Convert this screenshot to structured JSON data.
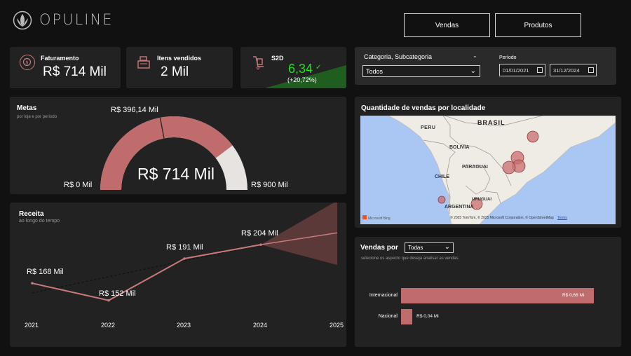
{
  "header": {
    "brand": "OPULINE",
    "nav": {
      "vendas": "Vendas",
      "produtos": "Produtos"
    }
  },
  "kpis": {
    "faturamento": {
      "title": "Faturamento",
      "value": "R$ 714 Mil"
    },
    "itens": {
      "title": "Itens vendidos",
      "value": "2 Mil"
    },
    "s2d": {
      "title": "S2D",
      "value": "6,34",
      "delta": "(+20,72%)",
      "accent": "#1ee01e"
    }
  },
  "filters": {
    "categoria_label": "Categoria, Subcategoria",
    "categoria_value": "Todos",
    "periodo_label": "Período",
    "date_start": "01/01/2021",
    "date_end": "31/12/2024"
  },
  "metas": {
    "title": "Metas",
    "subtitle": "por loja e por período",
    "center_value": "R$ 714 Mil",
    "min_label": "R$ 0 Mil",
    "max_label": "R$ 900 Mil",
    "target_label": "R$ 396,14 Mil",
    "value": 714,
    "min": 0,
    "max": 900,
    "target": 396.14,
    "fill_color": "#c06c6c",
    "rest_color": "#e7e3e0"
  },
  "mapa": {
    "title": "Quantidade de vendas por localidade",
    "labels": [
      "PERU",
      "BRASIL",
      "BOLIVIA",
      "PARAGUAI",
      "CHILE",
      "URUGUAI",
      "ARGENTINA"
    ],
    "attribution": "© 2025 TomTom, © 2025 Microsoft Corporation, © OpenStreetMap",
    "terms": "Terms",
    "bing": "Microsoft Bing"
  },
  "receita": {
    "title": "Receita",
    "subtitle": "ao longo do tempo"
  },
  "vendas_por": {
    "title": "Vendas por",
    "select_value": "Todas",
    "subtitle": "selecione os aspecto que deseja analisar as vendas",
    "bars": [
      {
        "label": "Internacional",
        "value": 0.68,
        "value_label": "R$ 0,68 Mi"
      },
      {
        "label": "Nacional",
        "value": 0.04,
        "value_label": "R$ 0,04 Mi"
      }
    ],
    "bar_color": "#c06c6c"
  },
  "chart_data": [
    {
      "type": "line",
      "title": "Receita",
      "x": [
        "2021",
        "2022",
        "2023",
        "2024",
        "2025"
      ],
      "series": [
        {
          "values": [
            168,
            152,
            191,
            204,
            null
          ]
        }
      ],
      "data_labels": [
        "R$ 168 Mil",
        "R$ 152 Mil",
        "R$ 191 Mil",
        "R$ 204 Mil"
      ],
      "forecast": {
        "from": "2024",
        "to": "2025",
        "value_2025": 215,
        "upper_2025": 245,
        "lower_2025": 185
      },
      "ylim": [
        140,
        225
      ],
      "line_color": "#c87a7a"
    },
    {
      "type": "bar",
      "title": "Vendas por",
      "categories": [
        "Internacional",
        "Nacional"
      ],
      "values": [
        0.68,
        0.04
      ],
      "data_labels": [
        "R$ 0,68 Mi",
        "R$ 0,04 Mi"
      ]
    }
  ]
}
